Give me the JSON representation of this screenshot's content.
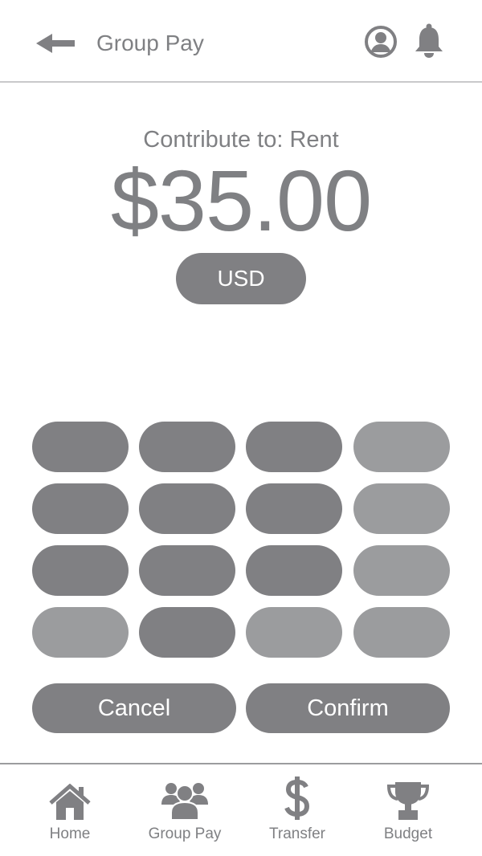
{
  "header": {
    "title": "Group Pay",
    "back_icon": "arrow-left-icon",
    "profile_icon": "user-circle-icon",
    "notification_icon": "bell-icon"
  },
  "payment": {
    "contribute_label": "Contribute to: Rent",
    "amount": "$35.00",
    "currency": "USD"
  },
  "actions": {
    "cancel_label": "Cancel",
    "confirm_label": "Confirm"
  },
  "nav": {
    "items": [
      {
        "label": "Home",
        "icon": "home-icon"
      },
      {
        "label": "Group Pay",
        "icon": "group-icon"
      },
      {
        "label": "Transfer",
        "icon": "dollar-icon"
      },
      {
        "label": "Budget",
        "icon": "trophy-icon"
      }
    ]
  },
  "colors": {
    "primary_gray": "#808083",
    "light_gray": "#9b9c9e",
    "text_gray": "#7f8083",
    "divider": "#c9c9cb",
    "background": "#ffffff"
  }
}
